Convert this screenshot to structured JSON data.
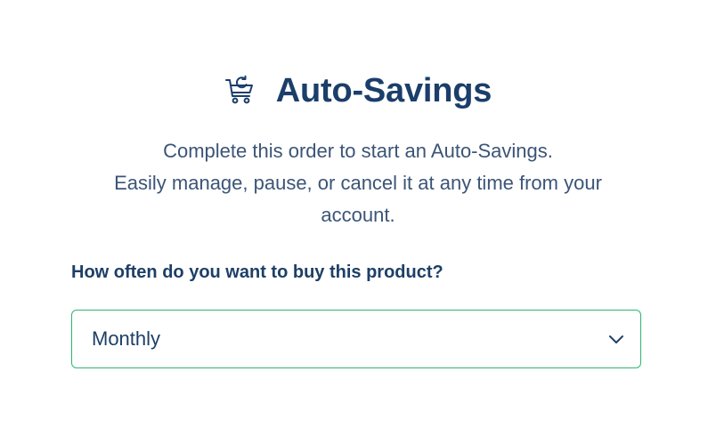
{
  "header": {
    "title": "Auto-Savings",
    "icon": "cart-refresh-icon"
  },
  "description": {
    "line1": "Complete this order to start an Auto-Savings.",
    "line2": "Easily manage, pause, or cancel it at any time from your",
    "line3": "account."
  },
  "frequency": {
    "question": "How often do you want to buy this product?",
    "selected": "Monthly",
    "icon": "chevron-down-icon"
  },
  "colors": {
    "primary_text": "#1b3e6a",
    "body_text": "#3b5576",
    "select_border": "#2fb574",
    "background": "#ffffff"
  }
}
